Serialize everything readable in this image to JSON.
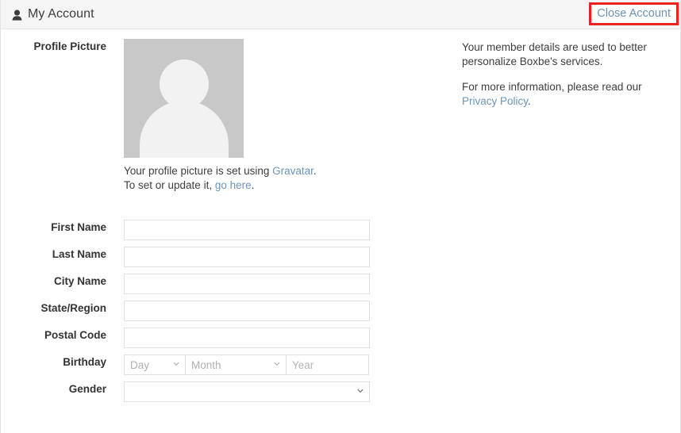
{
  "header": {
    "title": "My Account",
    "icon": "user-icon",
    "close_account_label": "Close Account",
    "highlight_color": "#e8231f",
    "link_color": "#6d93b7",
    "background": "#f5f5f5"
  },
  "profile": {
    "label": "Profile Picture",
    "avatar_alt": "default-avatar-silhouette",
    "avatar_color": "#c8c8c8",
    "caption_line1_prefix": "Your profile picture is set using ",
    "caption_line1_link": "Gravatar",
    "caption_line1_suffix": ".",
    "caption_line2_prefix": "To set or update it, ",
    "caption_line2_link": "go here",
    "caption_line2_suffix": "."
  },
  "form": {
    "fields": [
      {
        "name": "first-name",
        "label": "First Name",
        "value": "",
        "placeholder": "",
        "type": "text"
      },
      {
        "name": "last-name",
        "label": "Last Name",
        "value": "",
        "placeholder": "",
        "type": "text"
      },
      {
        "name": "city-name",
        "label": "City Name",
        "value": "",
        "placeholder": "",
        "type": "text"
      },
      {
        "name": "state-region",
        "label": "State/Region",
        "value": "",
        "placeholder": "",
        "type": "text"
      },
      {
        "name": "postal-code",
        "label": "Postal Code",
        "value": "",
        "placeholder": "",
        "type": "text"
      }
    ],
    "birthday": {
      "label": "Birthday",
      "day": {
        "selected": "Day",
        "options": [
          "Day"
        ]
      },
      "month": {
        "selected": "Month",
        "options": [
          "Month"
        ]
      },
      "year": {
        "value": "",
        "placeholder": "Year"
      }
    },
    "gender": {
      "label": "Gender",
      "selected": "",
      "options": [
        ""
      ]
    }
  },
  "notes": {
    "paragraph1": "Your member details are used to better personalize Boxbe's services.",
    "paragraph2_prefix": "For more information, please read our ",
    "paragraph2_link": "Privacy Policy",
    "paragraph2_suffix": "."
  }
}
